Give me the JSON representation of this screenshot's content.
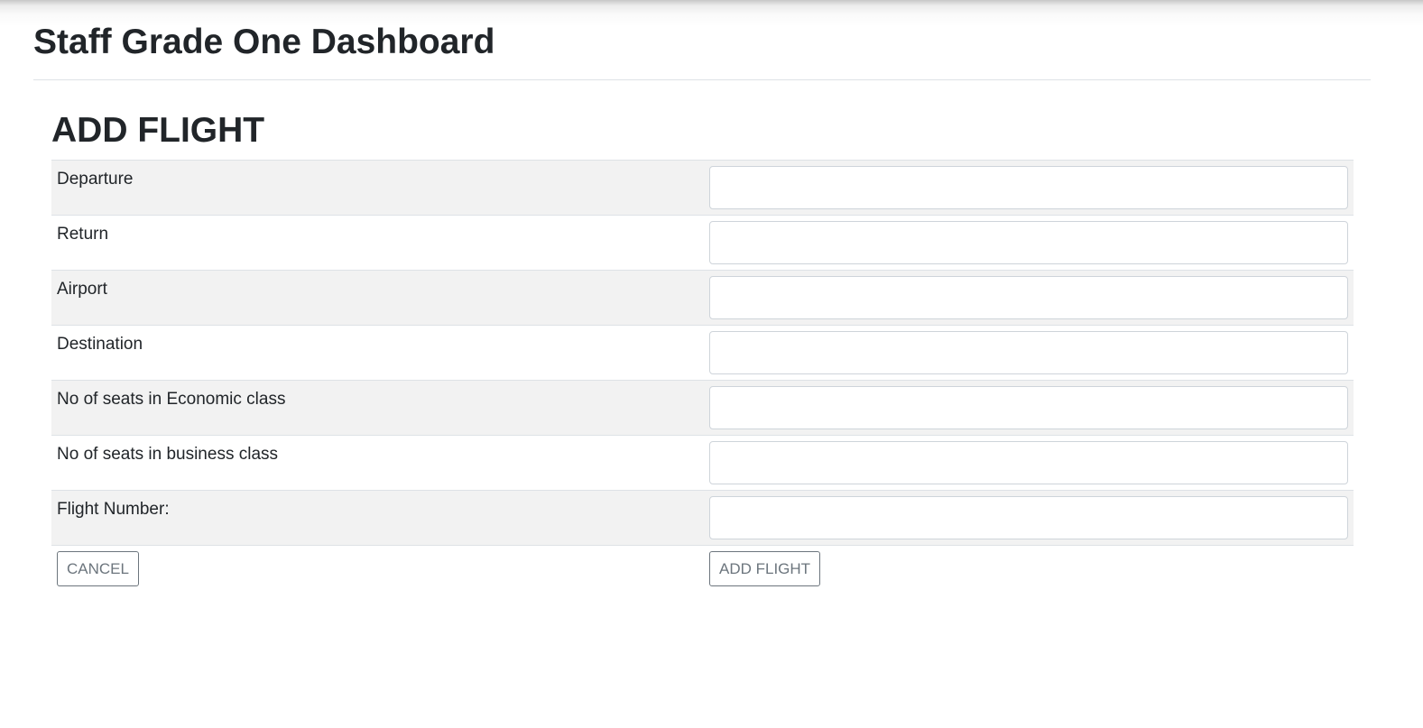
{
  "header": {
    "title": "Staff Grade One Dashboard"
  },
  "form": {
    "title": "ADD FLIGHT",
    "fields": [
      {
        "label": "Departure",
        "value": "",
        "placeholder": ""
      },
      {
        "label": "Return",
        "value": "",
        "placeholder": ""
      },
      {
        "label": "Airport",
        "value": "",
        "placeholder": ""
      },
      {
        "label": "Destination",
        "value": "",
        "placeholder": ""
      },
      {
        "label": "No of seats in Economic class",
        "value": "",
        "placeholder": ""
      },
      {
        "label": "No of seats in business class",
        "value": "",
        "placeholder": ""
      },
      {
        "label": "Flight Number:",
        "value": "",
        "placeholder": ""
      }
    ],
    "cancel_label": "CANCEL",
    "submit_label": "ADD FLIGHT"
  },
  "colors": {
    "row_stripe": "#f2f2f2",
    "button_outline": "#6c757d",
    "text": "#212529"
  }
}
